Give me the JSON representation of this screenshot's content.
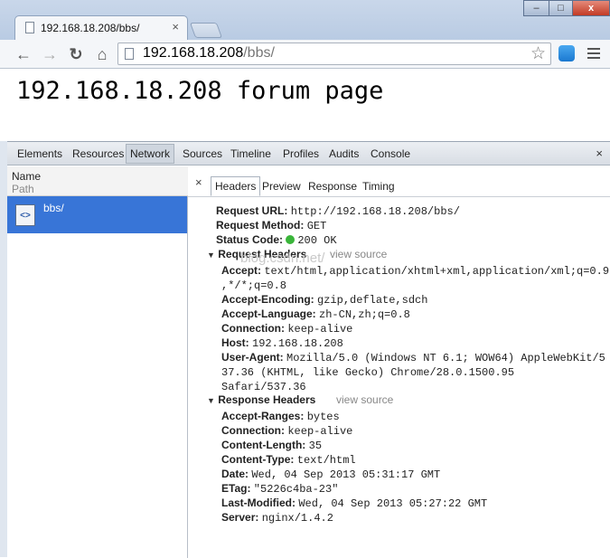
{
  "browser": {
    "tab_title": "192.168.18.208/bbs/",
    "tab_close": "×",
    "address_host": "192.168.18.208",
    "address_path": "/bbs/",
    "back_glyph": "←",
    "forward_glyph": "→",
    "reload_glyph": "↻",
    "home_glyph": "⌂",
    "star_glyph": "☆",
    "window_minimize": "–",
    "window_maximize": "□",
    "window_close": "x"
  },
  "page": {
    "heading": "192.168.18.208 forum page"
  },
  "devtools": {
    "tabs": [
      "Elements",
      "Resources",
      "Network",
      "Sources",
      "Timeline",
      "Profiles",
      "Audits",
      "Console"
    ],
    "selected_tab": "Network",
    "close": "×",
    "list_header_name": "Name",
    "list_header_path": "Path",
    "request_name": "bbs/",
    "request_icon": "<>",
    "detail_close": "×",
    "subtabs": [
      "Headers",
      "Preview",
      "Response",
      "Timing"
    ],
    "selected_subtab": "Headers",
    "general": {
      "url_label": "Request URL:",
      "url_value": "http://192.168.18.208/bbs/",
      "method_label": "Request Method:",
      "method_value": "GET",
      "status_label": "Status Code:",
      "status_value": "200 OK"
    },
    "request_headers_title": "Request Headers",
    "response_headers_title": "Response Headers",
    "view_source": "view source",
    "section_toggle": "▼",
    "request_headers": [
      {
        "key": "Accept:",
        "value": "text/html,application/xhtml+xml,application/xml;q=0.9"
      },
      {
        "key": "",
        "value": ",*/*;q=0.8"
      },
      {
        "key": "Accept-Encoding:",
        "value": "gzip,deflate,sdch"
      },
      {
        "key": "Accept-Language:",
        "value": "zh-CN,zh;q=0.8"
      },
      {
        "key": "Connection:",
        "value": "keep-alive"
      },
      {
        "key": "Host:",
        "value": "192.168.18.208"
      },
      {
        "key": "User-Agent:",
        "value": "Mozilla/5.0 (Windows NT 6.1; WOW64) AppleWebKit/5"
      },
      {
        "key": "",
        "value": "37.36 (KHTML, like Gecko) Chrome/28.0.1500.95"
      },
      {
        "key": "",
        "value": "Safari/537.36"
      }
    ],
    "response_headers": [
      {
        "key": "Accept-Ranges:",
        "value": "bytes"
      },
      {
        "key": "Connection:",
        "value": "keep-alive"
      },
      {
        "key": "Content-Length:",
        "value": "35"
      },
      {
        "key": "Content-Type:",
        "value": "text/html"
      },
      {
        "key": "Date:",
        "value": "Wed, 04 Sep 2013 05:31:17 GMT"
      },
      {
        "key": "ETag:",
        "value": "\"5226c4ba-23\""
      },
      {
        "key": "Last-Modified:",
        "value": "Wed, 04 Sep 2013 05:27:22 GMT"
      },
      {
        "key": "Server:",
        "value": "nginx/1.4.2"
      }
    ],
    "watermark": "blog.csdn.net/"
  },
  "colors": {
    "selected_row": "#3875d7",
    "status_ok": "#3ab53a",
    "window_close": "#c23b25"
  }
}
